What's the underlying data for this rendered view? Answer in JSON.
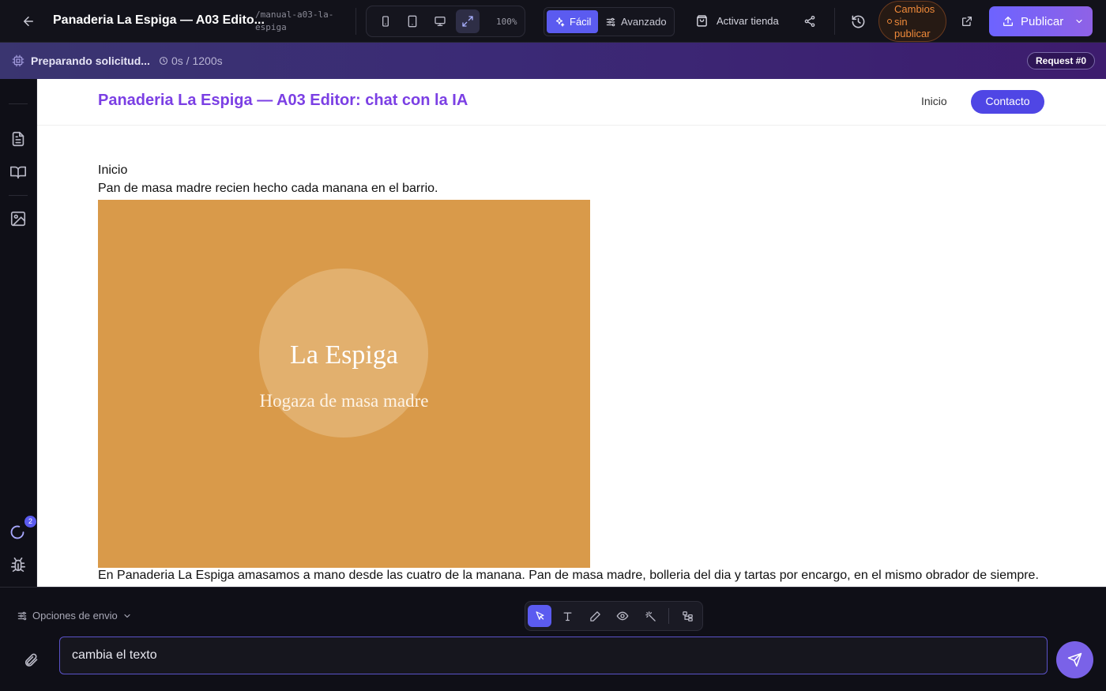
{
  "header": {
    "title": "Panaderia La Espiga — A03 Edito...",
    "slug": "/manual-a03-la-espiga",
    "zoom": "100%",
    "modes": [
      "Fácil",
      "Avanzado"
    ],
    "shop_label": "Activar tienda",
    "unpublished_label": "Cambios sin publicar",
    "publish_label": "Publicar"
  },
  "status": {
    "label": "Preparando solicitud...",
    "timer": "0s / 1200s",
    "request_badge": "Request #0"
  },
  "sidebar": {
    "badge_count": "2"
  },
  "site": {
    "title": "Panaderia La Espiga — A03 Editor: chat con la IA",
    "nav": [
      "Inicio",
      "Contacto"
    ],
    "section_heading": "Inicio",
    "tagline": "Pan de masa madre recien hecho cada manana en el barrio.",
    "hero_title": "La Espiga",
    "hero_subtitle": "Hogaza de masa madre",
    "body": "En Panaderia La Espiga amasamos a mano desde las cuatro de la manana. Pan de masa madre, bolleria del dia y tartas por encargo, en el mismo obrador de siempre."
  },
  "composer": {
    "send_options_label": "Opciones de envio",
    "prompt_value": "cambia el texto"
  },
  "colors": {
    "accent": "#5b5bf0",
    "site_title": "#7b3fe4",
    "hero_bg": "#d99a4a",
    "warning": "#f08a3a"
  }
}
